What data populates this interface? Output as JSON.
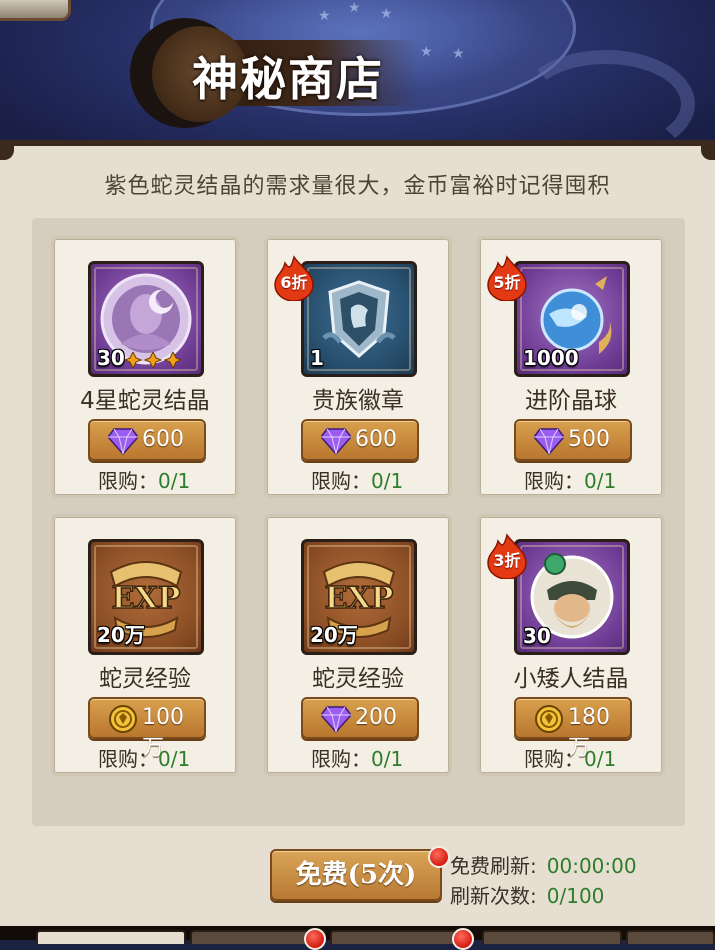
{
  "header": {
    "title": "神秘商店"
  },
  "shop": {
    "subtitle": "紫色蛇灵结晶的需求量很大，金币富裕时记得囤积",
    "limit_label": "限购："
  },
  "items": [
    {
      "name": "4星蛇灵结晶",
      "count": "30",
      "price": "600",
      "currency": "diamond-icon",
      "limit": "0/1",
      "discount": "",
      "frame": "purple"
    },
    {
      "name": "贵族徽章",
      "count": "1",
      "price": "600",
      "currency": "diamond-icon",
      "limit": "0/1",
      "discount": "6折",
      "frame": "blue"
    },
    {
      "name": "进阶晶球",
      "count": "1000",
      "price": "500",
      "currency": "diamond-icon",
      "limit": "0/1",
      "discount": "5折",
      "frame": "purple"
    },
    {
      "name": "蛇灵经验",
      "count": "20万",
      "price": "100万",
      "currency": "gold-coin-icon",
      "limit": "0/1",
      "discount": "",
      "frame": "brown"
    },
    {
      "name": "蛇灵经验",
      "count": "20万",
      "price": "200",
      "currency": "diamond-icon",
      "limit": "0/1",
      "discount": "",
      "frame": "brown"
    },
    {
      "name": "小矮人结晶",
      "count": "30",
      "price": "180万",
      "currency": "gold-coin-icon",
      "limit": "0/1",
      "discount": "3折",
      "frame": "purple"
    }
  ],
  "refresh": {
    "button_label": "免费(5次)",
    "free_refresh_label": "免费刷新:",
    "free_refresh_time": "00:00:00",
    "refresh_count_label": "刷新次数:",
    "refresh_count_value": "0/100"
  },
  "colors": {
    "accent_gold": "#c88a3c",
    "limit_green": "#2e7d2a",
    "badge_red": "#d41c12"
  }
}
